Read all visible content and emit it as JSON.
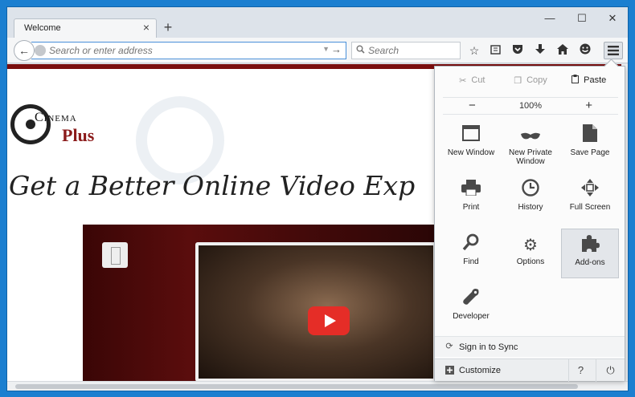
{
  "tab": {
    "title": "Welcome",
    "close": "×"
  },
  "new_tab": "+",
  "window_controls": {
    "minimize": "—",
    "maximize": "☐",
    "close": "✕"
  },
  "nav": {
    "back": "←",
    "url_placeholder": "Search or enter address",
    "url_drop": "▼",
    "url_go": "→",
    "search_placeholder": "Search"
  },
  "toolbar_icons": [
    "star-icon",
    "reading-list-icon",
    "pocket-icon",
    "download-icon",
    "home-icon",
    "hello-icon",
    "menu-icon"
  ],
  "page": {
    "logo_cinema": "Cinema",
    "logo_plus": "Plus",
    "headline": "Get a Better Online Video Exp"
  },
  "menu": {
    "cut": "Cut",
    "copy": "Copy",
    "paste": "Paste",
    "zoom_out": "−",
    "zoom_level": "100%",
    "zoom_in": "+",
    "items": [
      {
        "label": "New Window",
        "icon": "new-window-icon"
      },
      {
        "label": "New Private Window",
        "icon": "private-window-icon"
      },
      {
        "label": "Save Page",
        "icon": "save-page-icon"
      },
      {
        "label": "Print",
        "icon": "print-icon"
      },
      {
        "label": "History",
        "icon": "history-icon"
      },
      {
        "label": "Full Screen",
        "icon": "full-screen-icon"
      },
      {
        "label": "Find",
        "icon": "find-icon"
      },
      {
        "label": "Options",
        "icon": "options-icon"
      },
      {
        "label": "Add-ons",
        "icon": "add-ons-icon"
      },
      {
        "label": "Developer",
        "icon": "developer-icon"
      }
    ],
    "sign_in": "Sign in to Sync",
    "customize": "Customize",
    "help": "?",
    "quit": "⏻"
  },
  "colors": {
    "desktop": "#1b7fd0",
    "accent_red": "#7a0e0e",
    "play_red": "#e52d27"
  }
}
